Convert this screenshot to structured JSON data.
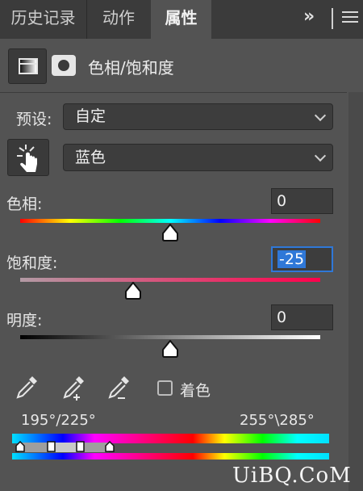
{
  "tabs": [
    {
      "label": "历史记录",
      "active": false
    },
    {
      "label": "动作",
      "active": false
    },
    {
      "label": "属性",
      "active": true
    }
  ],
  "panel_controls": {
    "more_icon": "double-chevron-right-icon",
    "menu_icon": "hamburger-menu-icon"
  },
  "header": {
    "adjustment_icon": "levels-adjustment-icon",
    "mask_icon": "layer-mask-icon",
    "title": "色相/饱和度"
  },
  "preset": {
    "label": "预设:",
    "value": "自定"
  },
  "channel": {
    "tool_icon": "targeted-adjustment-hand-icon",
    "value": "蓝色"
  },
  "hue": {
    "label": "色相:",
    "value": "0",
    "slider_fraction": 0.5
  },
  "saturation": {
    "label": "饱和度:",
    "value": "-25",
    "slider_fraction": 0.375
  },
  "lightness": {
    "label": "明度:",
    "value": "0",
    "slider_fraction": 0.5
  },
  "eyedroppers": [
    "eyedropper-icon",
    "eyedropper-add-icon",
    "eyedropper-subtract-icon"
  ],
  "colorize": {
    "label": "着色",
    "checked": false
  },
  "range": {
    "left_label": "195°/225°",
    "right_label": "255°\\285°"
  },
  "watermark": "UiBQ.CoM",
  "colors": {
    "panel_bg": "#535353",
    "tab_bg": "#3b3b3b",
    "field_bg": "#3d3d3d",
    "focus": "#2f78d8"
  }
}
